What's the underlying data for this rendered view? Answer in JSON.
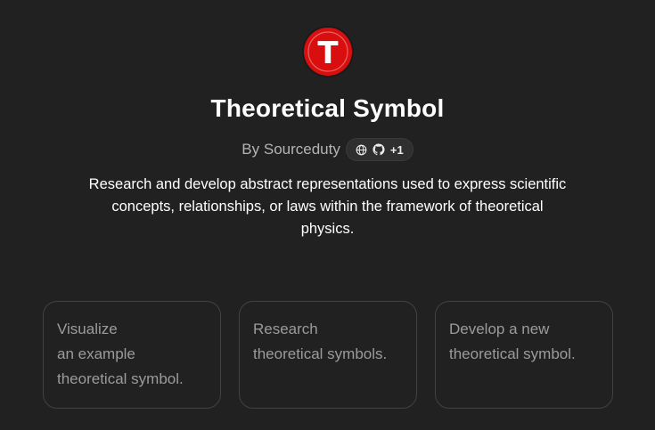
{
  "gpt": {
    "logo_letter": "T",
    "title": "Theoretical Symbol",
    "byline": "By Sourceduty",
    "links": {
      "icons": [
        "globe-icon",
        "github-icon"
      ],
      "extra_count": "+1"
    },
    "description_lines": [
      "Research and develop abstract representations used to express scientific",
      "concepts, relationships, or laws within the framework of theoretical",
      "physics."
    ]
  },
  "starters": [
    {
      "lines": [
        "Visualize",
        "an example",
        "theoretical symbol."
      ]
    },
    {
      "lines": [
        "Research",
        "theoretical symbols."
      ]
    },
    {
      "lines": [
        "Develop a new",
        "theoretical symbol."
      ]
    }
  ],
  "colors": {
    "background": "#212121",
    "logo_red": "#d90f0f",
    "card_border": "#424242",
    "muted_text": "#9b9b9b"
  }
}
